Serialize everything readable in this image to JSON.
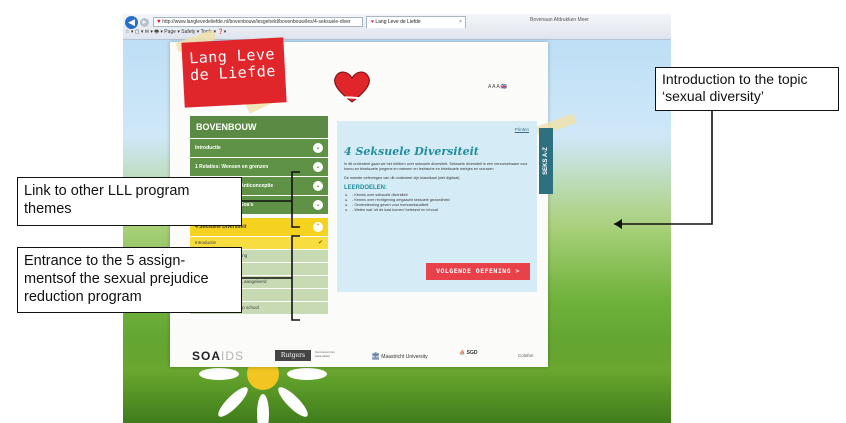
{
  "browser": {
    "address_url": "http://www.langlevedeliefde.nl/bovenbouw/lesgeheld/bovenbouw/les/4-seksuele-diver",
    "tab_title": "Lang Leve de Liefde",
    "tab_close": "×",
    "back_glyph": "◀",
    "forward_glyph": "▸",
    "toolbar_right": "Bovenaan   Afdrukken   Meer",
    "command_bar": "☆ ▾  ▢ ▾  ✉ ▾  🖶 ▾  Page ▾  Safety ▾  Tools ▾  ❓▾"
  },
  "site": {
    "logo_line1": "Lang Leve",
    "logo_line2": "de Liefde",
    "lang_controls": "A A A 🇬🇧",
    "print_link": "Printen",
    "side_tab": "SEKS A-Z"
  },
  "menu": {
    "heading": "BOVENBOUW",
    "chevron_down": "⌄",
    "chevron_up": "⌃",
    "items": [
      {
        "label": "Introductie"
      },
      {
        "label": "1 Relaties: Wensen en grenzen"
      },
      {
        "label": "2 (On)Veilig vrijen: Anticonceptie"
      },
      {
        "label": "3 (On)Veilig vrijen: Soa's"
      },
      {
        "label": "4 Seksuele Diversiteit"
      }
    ],
    "sub_items": [
      {
        "label": "Introductie",
        "check": "✔"
      },
      {
        "label": "oefening 1 Cirkel oefening"
      },
      {
        "label": "oefening 2 Wat is wat?"
      },
      {
        "label": "oefening 3 Aangeboren, aangeleerd"
      },
      {
        "label": "oefening 4 Coming out"
      },
      {
        "label": "oefening 5 Uit de kast op school"
      }
    ]
  },
  "content": {
    "title": "4 Seksuele Diversiteit",
    "para1": "In dit onderdeel gaan we het hebben over seksuele diversiteit. Seksuele diversiteit is een verzamelnaam voor homo-en biseksuele jongens en mannen en lesbische en biseksuele meisjes en vrouwen.",
    "para2": "De meeste oefeningen van dit onderdeel zijn klassikaal (niet digitaal).",
    "goals_heading": "LEERDOELEN:",
    "goals": [
      "- Kennis over seksuele diversiteit",
      "- Kennis over rechtgeving omgaacht seksuele gezondheid",
      "- Ondersteuning geven voor homoseksualiteit",
      "- Weten wat 'uit de kast komen' betekent en inhoud"
    ],
    "next_button": "VOLGENDE OEFENING  >"
  },
  "footer": {
    "soaids_a": "SOA",
    "soaids_b": "IDS",
    "rutgers": "Rutgers",
    "rutgers_sub": "Kenniscentrum seksualiteit",
    "maastricht_mark": "🏛",
    "maastricht": "Maastricht University",
    "sgd_mark": "⛵",
    "sgd": "SGD",
    "colofon": "Colofon"
  },
  "annotations": {
    "link_themes": "Link to other LLL program themes",
    "entrance": "Entrance to the 5 assign- mentsof the sexual prejudice reduction program",
    "intro_topic": "Introduction to the topic ‘sexual diversity’"
  },
  "colors": {
    "logo_red": "#e0252b",
    "menu_green": "#5f9147",
    "menu_active": "#f5d21f",
    "content_bg": "#d5ecf6",
    "accent_teal": "#238d9c",
    "button_red": "#e8414a"
  }
}
